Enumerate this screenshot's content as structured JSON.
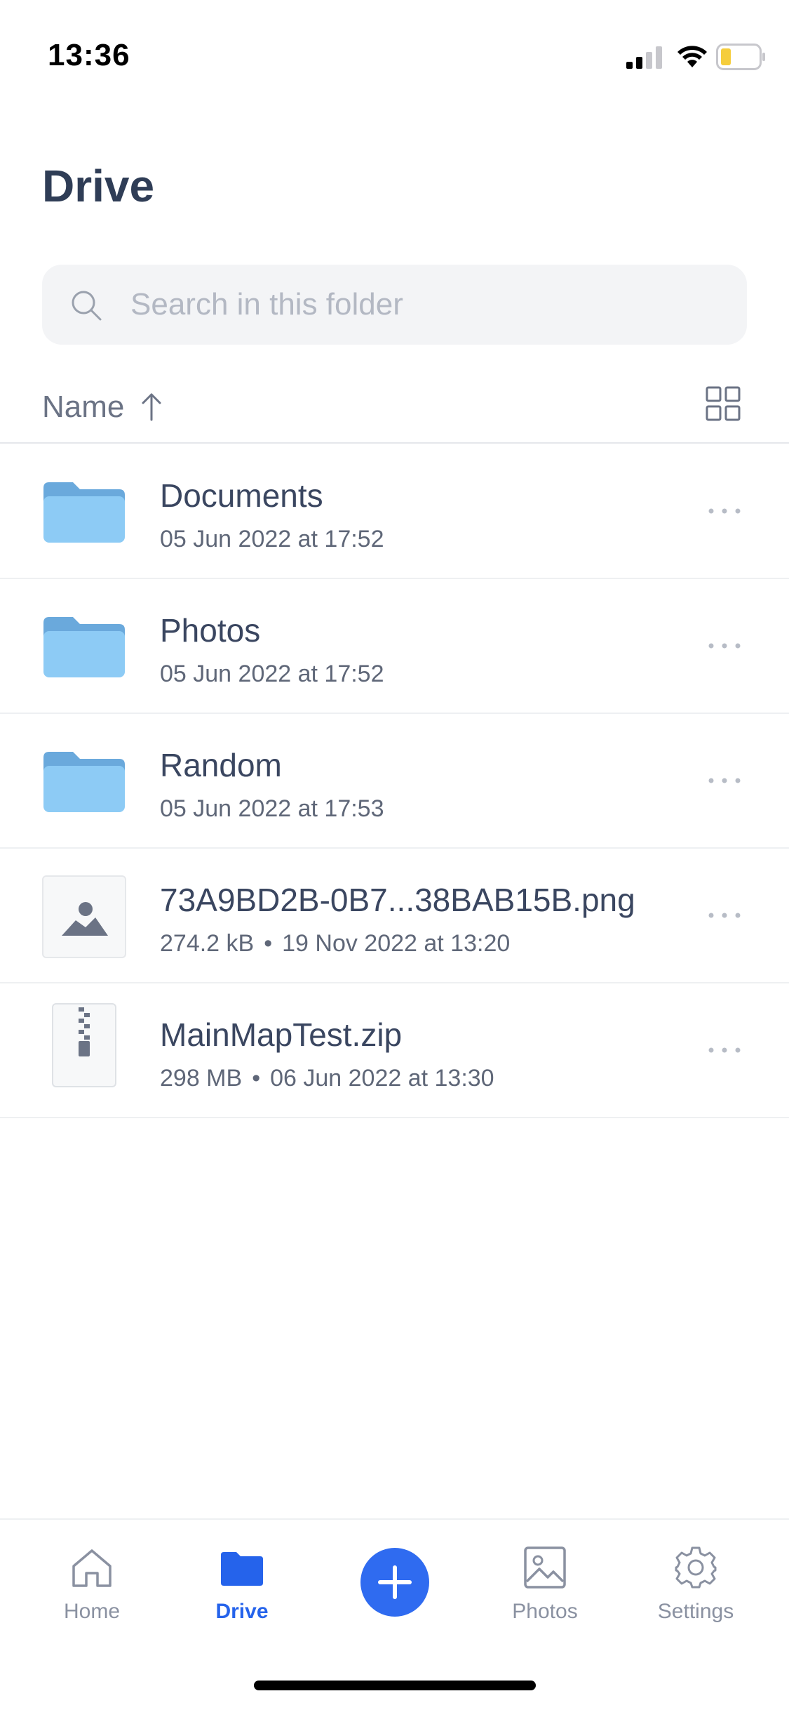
{
  "status_bar": {
    "time": "13:36"
  },
  "page": {
    "title": "Drive"
  },
  "search": {
    "placeholder": "Search in this folder"
  },
  "sort": {
    "label": "Name"
  },
  "files": [
    {
      "name": "Documents",
      "meta": "05 Jun 2022 at 17:52",
      "kind": "folder"
    },
    {
      "name": "Photos",
      "meta": "05 Jun 2022 at 17:52",
      "kind": "folder"
    },
    {
      "name": "Random",
      "meta": "05 Jun 2022 at 17:53",
      "kind": "folder"
    },
    {
      "name": "73A9BD2B-0B7...38BAB15B.png",
      "size": "274.2 kB",
      "date": "19 Nov 2022 at 13:20",
      "kind": "image"
    },
    {
      "name": "MainMapTest.zip",
      "size": "298 MB",
      "date": "06 Jun 2022 at 13:30",
      "kind": "zip"
    }
  ],
  "meta_separator": "•",
  "nav": {
    "home": "Home",
    "drive": "Drive",
    "photos": "Photos",
    "settings": "Settings"
  },
  "icons": {
    "folder": "folder-icon",
    "image": "image-file-icon",
    "zip": "zip-file-icon",
    "more": "more-horizontal-icon",
    "grid": "grid-view-icon",
    "search": "search-icon"
  },
  "colors": {
    "accent": "#2563eb",
    "folder_light": "#8dcbf5",
    "folder_dark": "#6aa9dc",
    "text_primary": "#2f3d56",
    "text_muted": "#8a91a1"
  }
}
